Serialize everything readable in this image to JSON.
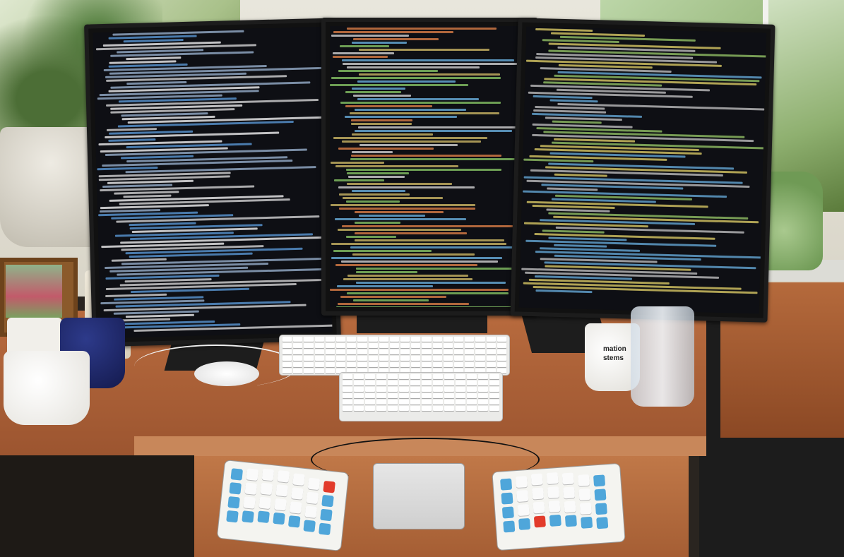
{
  "scene": {
    "description_tag": "desk-with-three-monitors",
    "colors": {
      "desk": "#a85c33",
      "screen_bg": "#0e0f14",
      "keycap_blue": "#4fa6da",
      "keycap_white": "#fafafa",
      "keycap_red": "#e23b2b"
    }
  },
  "monitors": {
    "left": {
      "content": "terminal-process-list"
    },
    "center": {
      "content": "code-editor"
    },
    "right": {
      "content": "vim-config"
    }
  },
  "mug_right_text": "mation\nstems"
}
